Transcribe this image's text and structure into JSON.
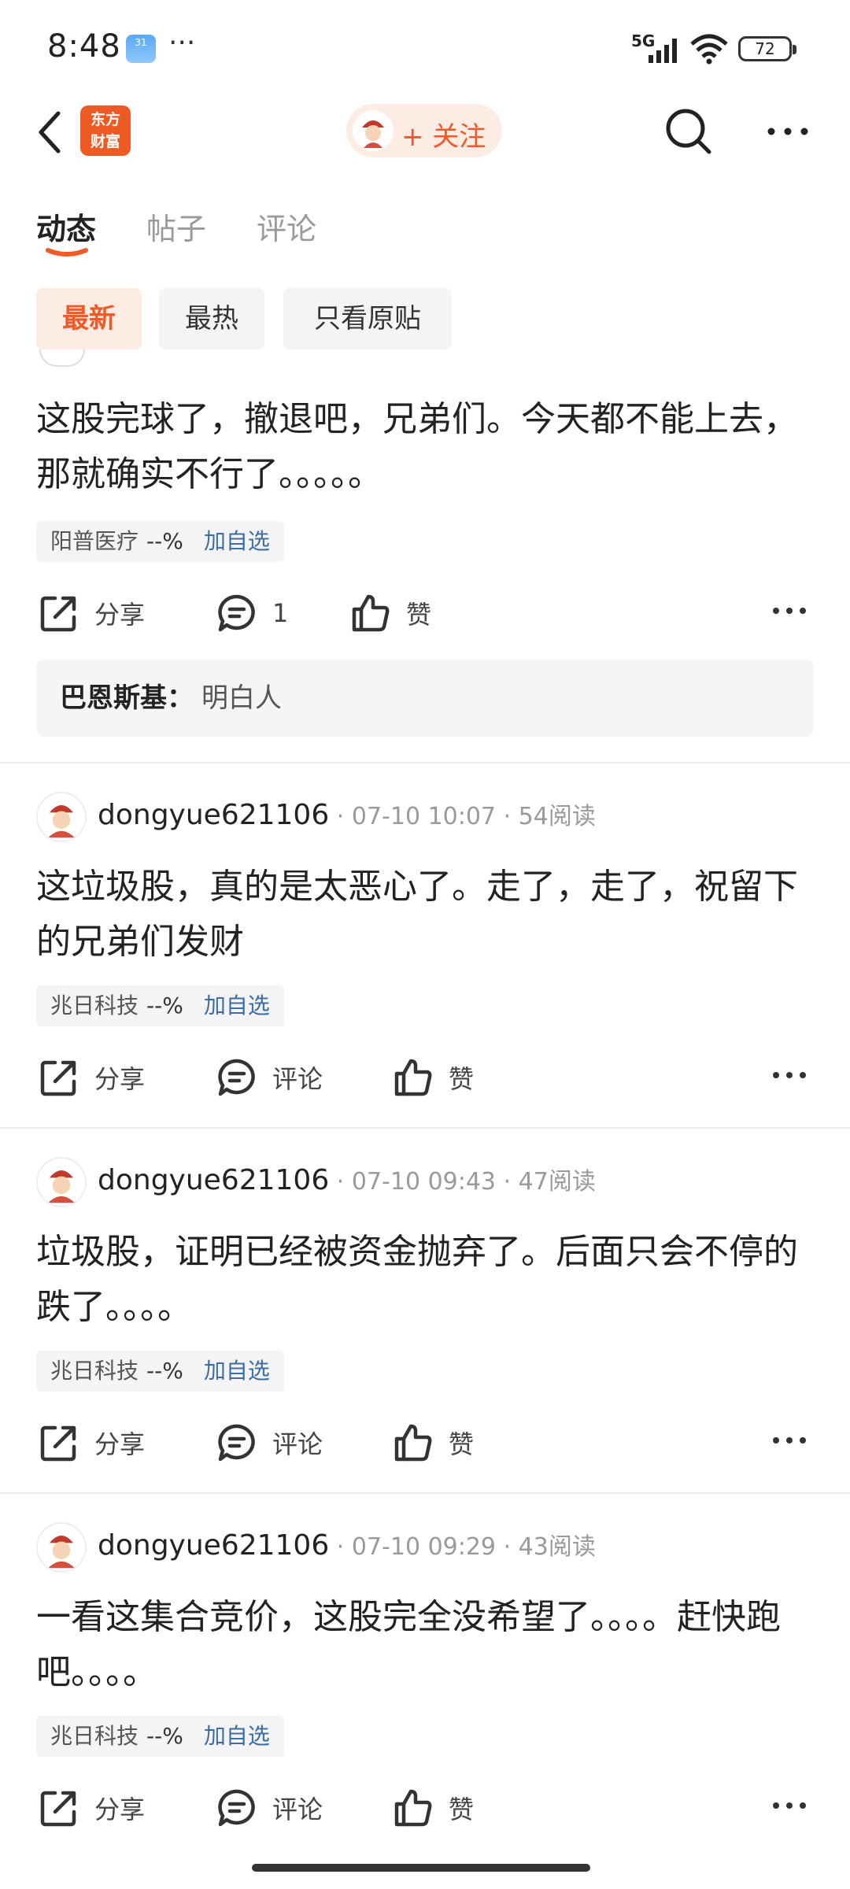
{
  "status_bar": {
    "time": "8:48",
    "calendar_day": "31",
    "dots": "···",
    "network": "5G",
    "battery": "72"
  },
  "top_nav": {
    "logo_text_line1": "东方",
    "logo_text_line2": "财富",
    "follow_label": "+ 关注"
  },
  "tabs": [
    {
      "label": "动态",
      "active": true
    },
    {
      "label": "帖子",
      "active": false
    },
    {
      "label": "评论",
      "active": false
    }
  ],
  "filters": [
    {
      "label": "最新",
      "active": true
    },
    {
      "label": "最热",
      "active": false
    },
    {
      "label": "只看原贴",
      "active": false
    }
  ],
  "posts": [
    {
      "text": "这股完球了，撤退吧，兄弟们。今天都不能上去，那就确实不行了。。。。。",
      "stock_name": "阳普医疗",
      "stock_pct": "--%",
      "add_label": "加自选",
      "share_label": "分享",
      "comment_label": "1",
      "like_label": "赞",
      "reply": {
        "author": "巴恩斯基：",
        "message": "明白人"
      }
    },
    {
      "username": "dongyue621106",
      "time": "07-10 10:07",
      "reads": "54阅读",
      "text": "这垃圾股，真的是太恶心了。走了，走了，祝留下的兄弟们发财",
      "stock_name": "兆日科技",
      "stock_pct": "--%",
      "add_label": "加自选",
      "share_label": "分享",
      "comment_label": "评论",
      "like_label": "赞"
    },
    {
      "username": "dongyue621106",
      "time": "07-10 09:43",
      "reads": "47阅读",
      "text": "垃圾股，证明已经被资金抛弃了。后面只会不停的跌了。。。。",
      "stock_name": "兆日科技",
      "stock_pct": "--%",
      "add_label": "加自选",
      "share_label": "分享",
      "comment_label": "评论",
      "like_label": "赞"
    },
    {
      "username": "dongyue621106",
      "time": "07-10 09:29",
      "reads": "43阅读",
      "text": "一看这集合竞价，这股完全没希望了。。。。赶快跑吧。。。。",
      "stock_name": "兆日科技",
      "stock_pct": "--%",
      "add_label": "加自选",
      "share_label": "分享",
      "comment_label": "评论",
      "like_label": "赞"
    }
  ],
  "colors": {
    "accent": "#ef5a28",
    "link": "#3a6ea5",
    "chip_bg": "#f4f4f6"
  }
}
